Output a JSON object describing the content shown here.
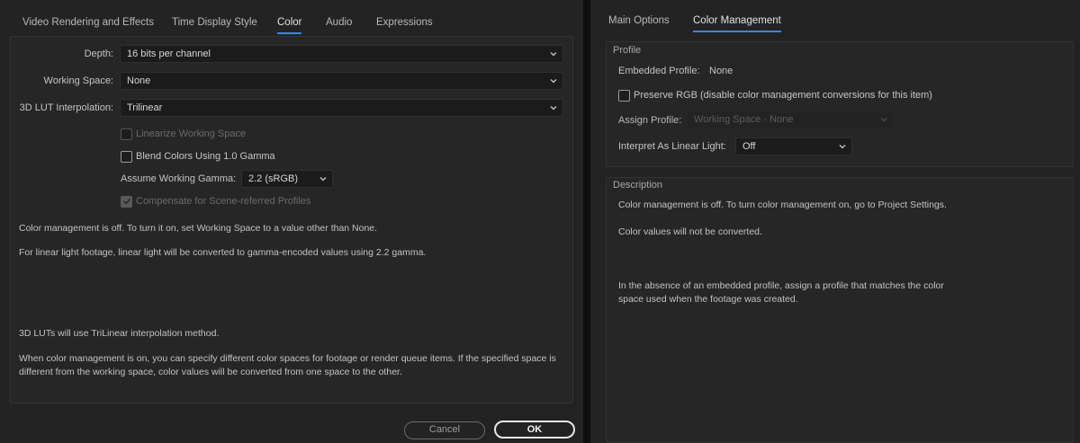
{
  "left": {
    "tabs": [
      {
        "label": "Video Rendering and Effects",
        "active": false
      },
      {
        "label": "Time Display Style",
        "active": false
      },
      {
        "label": "Color",
        "active": true
      },
      {
        "label": "Audio",
        "active": false
      },
      {
        "label": "Expressions",
        "active": false
      }
    ],
    "depth": {
      "label": "Depth:",
      "value": "16 bits per channel"
    },
    "working_space": {
      "label": "Working Space:",
      "value": "None"
    },
    "lut_interp": {
      "label": "3D LUT Interpolation:",
      "value": "Trilinear"
    },
    "linearize": {
      "label": "Linearize Working Space",
      "checked": false,
      "disabled": true
    },
    "blend": {
      "label": "Blend Colors Using 1.0 Gamma",
      "checked": false,
      "disabled": false
    },
    "gamma": {
      "label": "Assume Working Gamma:",
      "value": "2.2 (sRGB)"
    },
    "compensate": {
      "label": "Compensate for Scene-referred Profiles",
      "checked": true,
      "disabled": true
    },
    "info": {
      "p1": "Color management is off. To turn it on, set Working Space to a value other than None.",
      "p2": "For linear light footage, linear light will be converted to gamma-encoded values using 2.2 gamma.",
      "p3": "3D LUTs will use TriLinear interpolation method.",
      "p4a": "When color management is on, you can specify different color spaces for footage or render queue items. If the specified space is",
      "p4b": "different from the working space, color values will be converted from one space to the other."
    },
    "buttons": {
      "cancel": "Cancel",
      "ok": "OK"
    }
  },
  "right": {
    "tabs": [
      {
        "label": "Main Options",
        "active": false
      },
      {
        "label": "Color Management",
        "active": true
      }
    ],
    "profile": {
      "title": "Profile",
      "embedded_label": "Embedded Profile:",
      "embedded_value": "None",
      "preserve_rgb": "Preserve RGB (disable color management conversions for this item)",
      "assign_label": "Assign Profile:",
      "assign_value": "Working Space - None",
      "interpret_label": "Interpret As Linear Light:",
      "interpret_value": "Off"
    },
    "description": {
      "title": "Description",
      "d1": "Color management is off. To turn color management on, go to Project Settings.",
      "d2": "Color values will not be converted.",
      "d3a": "In the absence of an embedded profile, assign a profile that matches the color",
      "d3b": "space used when the footage was created."
    }
  },
  "colors": {
    "accent": "#2d8ceb",
    "background": "#232323"
  }
}
